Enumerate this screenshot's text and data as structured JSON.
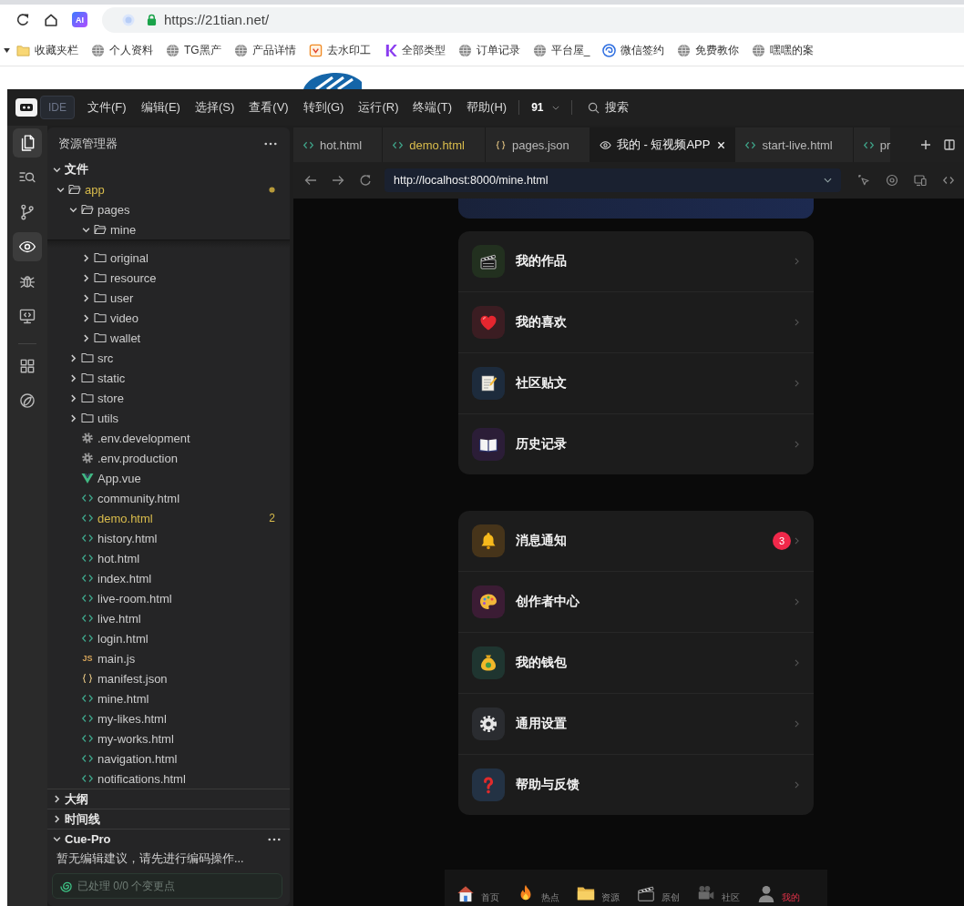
{
  "browser": {
    "ai_label": "AI",
    "url": "https://21tian.net/",
    "bookmarks": [
      {
        "label": "收藏夹栏",
        "kind": "folder"
      },
      {
        "label": "个人资料",
        "kind": "globe"
      },
      {
        "label": "TG黑产",
        "kind": "globe"
      },
      {
        "label": "产品详情",
        "kind": "globe"
      },
      {
        "label": "去水印工",
        "kind": "square"
      },
      {
        "label": "全部类型",
        "kind": "k"
      },
      {
        "label": "订单记录",
        "kind": "globe"
      },
      {
        "label": "平台屋_",
        "kind": "globe"
      },
      {
        "label": "微信签约",
        "kind": "swirl"
      },
      {
        "label": "免费教你",
        "kind": "globe"
      },
      {
        "label": "嘿嘿的案",
        "kind": "globe"
      }
    ]
  },
  "ide": {
    "badge": "IDE",
    "menu": [
      "文件(F)",
      "编辑(E)",
      "选择(S)",
      "查看(V)",
      "转到(G)",
      "运行(R)",
      "终端(T)",
      "帮助(H)"
    ],
    "project": "91",
    "search": "搜索"
  },
  "activity_groups": [
    [
      {
        "kind": "explorer",
        "selected": true
      },
      {
        "kind": "search",
        "selected": false
      },
      {
        "kind": "git",
        "selected": false
      },
      {
        "kind": "preview",
        "selected": true
      },
      {
        "kind": "debug",
        "selected": false
      },
      {
        "kind": "remote",
        "selected": false
      }
    ],
    [
      {
        "kind": "extensions",
        "selected": false
      },
      {
        "kind": "cue",
        "selected": false
      }
    ]
  ],
  "sidebar": {
    "title": "资源管理器",
    "section": {
      "label": "文件",
      "expanded": true
    },
    "tree": [
      {
        "name": "app",
        "kind": "folder",
        "expanded": true,
        "modified": true,
        "children": [
          {
            "name": "pages",
            "kind": "folder",
            "expanded": true,
            "modified": false,
            "children": [
              {
                "name": "mine",
                "kind": "folder",
                "expanded": true,
                "modified": false
              },
              {
                "name": "original",
                "kind": "folder",
                "expanded": false,
                "modified": false
              },
              {
                "name": "resource",
                "kind": "folder",
                "expanded": false,
                "modified": false
              },
              {
                "name": "user",
                "kind": "folder",
                "expanded": false,
                "modified": false
              },
              {
                "name": "video",
                "kind": "folder",
                "expanded": false,
                "modified": false
              },
              {
                "name": "wallet",
                "kind": "folder",
                "expanded": false,
                "modified": false
              }
            ]
          },
          {
            "name": "src",
            "kind": "folder",
            "expanded": false,
            "modified": false
          },
          {
            "name": "static",
            "kind": "folder",
            "expanded": false,
            "modified": false
          },
          {
            "name": "store",
            "kind": "folder",
            "expanded": false,
            "modified": false
          },
          {
            "name": "utils",
            "kind": "folder",
            "expanded": false,
            "modified": false
          },
          {
            "name": ".env.development",
            "kind": "config",
            "modified": false
          },
          {
            "name": ".env.production",
            "kind": "config",
            "modified": false
          },
          {
            "name": "App.vue",
            "kind": "vue",
            "modified": false
          },
          {
            "name": "community.html",
            "kind": "html",
            "modified": false
          },
          {
            "name": "demo.html",
            "kind": "html",
            "modified": true,
            "count": "2"
          },
          {
            "name": "history.html",
            "kind": "html",
            "modified": false
          },
          {
            "name": "hot.html",
            "kind": "html",
            "modified": false
          },
          {
            "name": "index.html",
            "kind": "html",
            "modified": false
          },
          {
            "name": "live-room.html",
            "kind": "html",
            "modified": false
          },
          {
            "name": "live.html",
            "kind": "html",
            "modified": false
          },
          {
            "name": "login.html",
            "kind": "html",
            "modified": false
          },
          {
            "name": "main.js",
            "kind": "js",
            "modified": false,
            "icon_label": "JS"
          },
          {
            "name": "manifest.json",
            "kind": "json",
            "modified": false
          },
          {
            "name": "mine.html",
            "kind": "html",
            "modified": false
          },
          {
            "name": "my-likes.html",
            "kind": "html",
            "modified": false
          },
          {
            "name": "my-works.html",
            "kind": "html",
            "modified": false
          },
          {
            "name": "navigation.html",
            "kind": "html",
            "modified": false
          },
          {
            "name": "notifications.html",
            "kind": "html",
            "modified": false
          }
        ]
      }
    ],
    "panels": [
      {
        "title": "大纲",
        "expanded": false
      },
      {
        "title": "时间线",
        "expanded": false
      },
      {
        "title": "Cue-Pro",
        "expanded": true,
        "message": "暂无编辑建议，请先进行编码操作...",
        "status": "已处理 0/0 个变更点"
      }
    ]
  },
  "editor": {
    "tabs": [
      {
        "label": "hot.html",
        "kind": "html",
        "selected": false,
        "modified": false
      },
      {
        "label": "demo.html",
        "kind": "html",
        "selected": false,
        "modified": true
      },
      {
        "label": "pages.json",
        "kind": "json",
        "selected": false,
        "modified": false
      },
      {
        "label": "我的 - 短视频APP",
        "kind": "preview",
        "selected": true,
        "modified": false
      },
      {
        "label": "start-live.html",
        "kind": "html",
        "selected": false,
        "modified": false
      },
      {
        "label": "pr",
        "kind": "html",
        "selected": false,
        "modified": false
      }
    ],
    "preview": {
      "url": "http://localhost:8000/mine.html",
      "menu_groups": [
        [
          {
            "label": "我的作品",
            "kind": "clapper"
          },
          {
            "label": "我的喜欢",
            "kind": "heart"
          },
          {
            "label": "社区贴文",
            "kind": "memo"
          },
          {
            "label": "历史记录",
            "kind": "book"
          }
        ],
        [
          {
            "label": "消息通知",
            "kind": "bell",
            "badge": "3"
          },
          {
            "label": "创作者中心",
            "kind": "palette"
          },
          {
            "label": "我的钱包",
            "kind": "bag"
          },
          {
            "label": "通用设置",
            "kind": "gear"
          },
          {
            "label": "帮助与反馈",
            "kind": "question"
          }
        ]
      ],
      "nav": [
        {
          "label": "首页",
          "kind": "home",
          "selected": false
        },
        {
          "label": "热点",
          "kind": "hot",
          "selected": false
        },
        {
          "label": "资源",
          "kind": "folder",
          "selected": false
        },
        {
          "label": "原创",
          "kind": "clapper",
          "selected": false
        },
        {
          "label": "社区",
          "kind": "camera",
          "selected": false
        },
        {
          "label": "我的",
          "kind": "me",
          "selected": true
        }
      ]
    }
  }
}
